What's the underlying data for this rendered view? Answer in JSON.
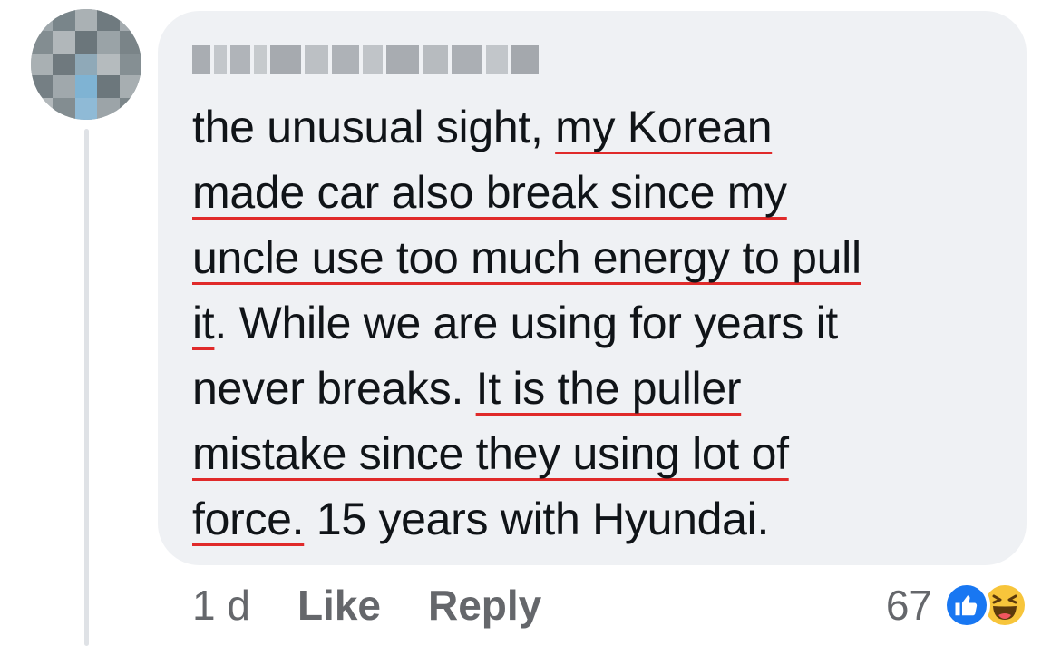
{
  "comment": {
    "author_name": "",
    "lines": [
      [
        "the unusual sight, ",
        "my Korean",
        ""
      ],
      [
        "",
        "made car also break since my",
        ""
      ],
      [
        "",
        "uncle use too much energy to pull",
        ""
      ],
      [
        "",
        "it",
        ". While we are using for years it"
      ],
      [
        "never breaks. ",
        "It is the puller",
        ""
      ],
      [
        "",
        "mistake since they using lot of",
        ""
      ],
      [
        "",
        "force.",
        " 15 years with Hyundai."
      ]
    ],
    "underline_color": "#e02a2a"
  },
  "meta": {
    "time": "1 d",
    "like_label": "Like",
    "reply_label": "Reply"
  },
  "reactions": {
    "count": "67",
    "types": [
      "like-icon",
      "haha-icon"
    ]
  },
  "colors": {
    "bubble": "#eff1f4",
    "text": "#101418",
    "meta": "#65676b",
    "like_blue": "#1877f2",
    "haha_yellow": "#f7c53b"
  }
}
